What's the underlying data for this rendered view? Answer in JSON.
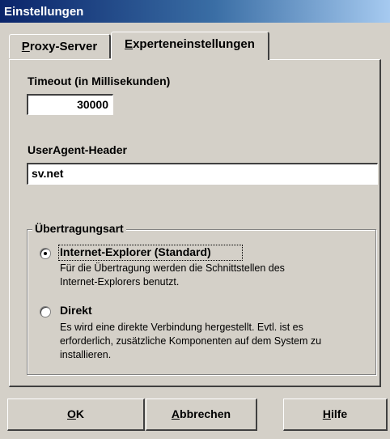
{
  "window": {
    "title": "Einstellungen"
  },
  "tabs": [
    {
      "label": "Proxy-Server",
      "accel": "P",
      "rest": "roxy-Server"
    },
    {
      "label": "Experteneinstellungen",
      "accel": "E",
      "rest": "xperteneinstellungen"
    }
  ],
  "timeout": {
    "label": "Timeout (in Millisekunden)",
    "value": "30000"
  },
  "useragent": {
    "label": "UserAgent-Header",
    "value": "sv.net"
  },
  "transfer": {
    "legend": "Übertragungsart",
    "options": [
      {
        "label": "Internet-Explorer (Standard)",
        "selected": true,
        "lines": [
          "Für die Übertragung werden die Schnittstellen des",
          "Internet-Explorers benutzt."
        ]
      },
      {
        "label": "Direkt",
        "selected": false,
        "lines": [
          "Es wird eine direkte Verbindung hergestellt. Evtl. ist es",
          "erforderlich, zusätzliche Komponenten auf dem System zu",
          "installieren."
        ]
      }
    ]
  },
  "buttons": {
    "ok": {
      "accel": "O",
      "rest": "K"
    },
    "cancel": {
      "accel": "A",
      "rest": "bbrechen"
    },
    "help": {
      "accel": "H",
      "rest": "ilfe"
    }
  }
}
